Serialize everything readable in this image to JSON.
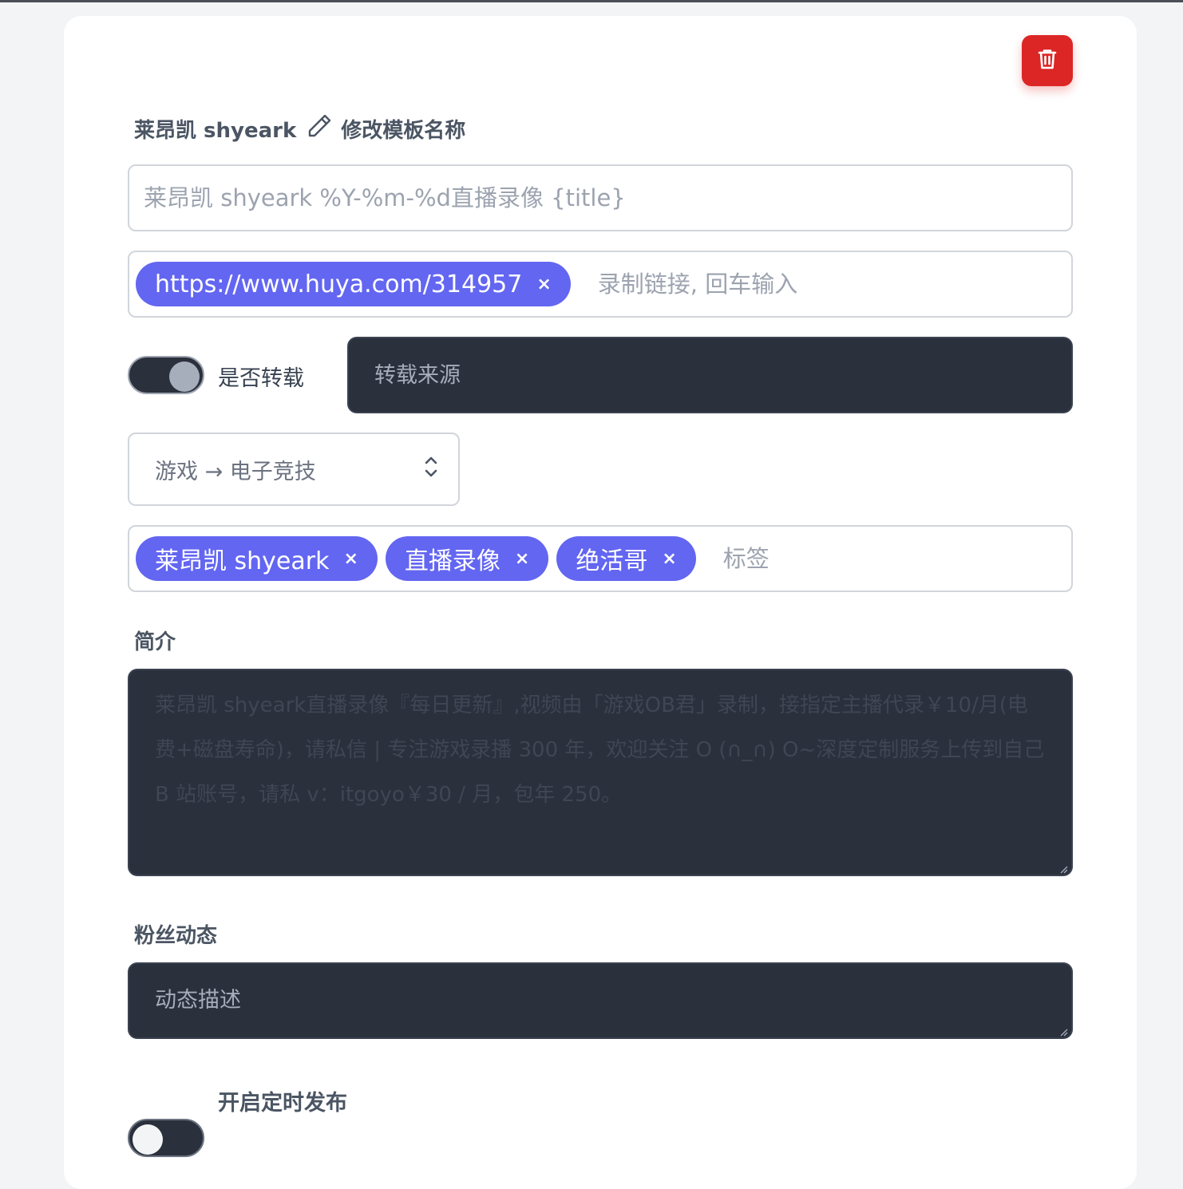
{
  "template": {
    "name": "莱昂凯 shyeark",
    "edit_label": "修改模板名称"
  },
  "title_input": {
    "placeholder": "莱昂凯 shyeark %Y-%m-%d直播录像 {title}"
  },
  "links": {
    "chips": [
      {
        "label": "https://www.huya.com/314957",
        "remove": "×"
      }
    ],
    "placeholder": "录制链接, 回车输入"
  },
  "repost": {
    "toggle_on": true,
    "label": "是否转载",
    "source_placeholder": "转载来源"
  },
  "category": {
    "selected": "游戏 → 电子竞技"
  },
  "tags": {
    "chips": [
      {
        "label": "莱昂凯 shyeark",
        "remove": "×"
      },
      {
        "label": "直播录像",
        "remove": "×"
      },
      {
        "label": "绝活哥",
        "remove": "×"
      }
    ],
    "placeholder": "标签"
  },
  "description": {
    "label": "简介",
    "placeholder": "莱昂凯 shyeark直播录像『每日更新』,视频由「游戏OB君」录制，接指定主播代录￥10/月(电费+磁盘寿命)，请私信 | 专注游戏录播 300 年，欢迎关注 O (∩_∩) O~深度定制服务上传到自己 B 站账号，请私 v：itgoyo￥30 / 月，包年 250。"
  },
  "fans_dynamic": {
    "label": "粉丝动态",
    "placeholder": "动态描述"
  },
  "schedule": {
    "toggle_on": false,
    "label": "开启定时发布"
  },
  "colors": {
    "accent": "#6366f1",
    "danger": "#dc2626",
    "dark_input": "#2a303c"
  },
  "icons": {
    "delete": "trash-icon",
    "edit": "pencil-icon",
    "select": "chevron-up-down-icon"
  }
}
